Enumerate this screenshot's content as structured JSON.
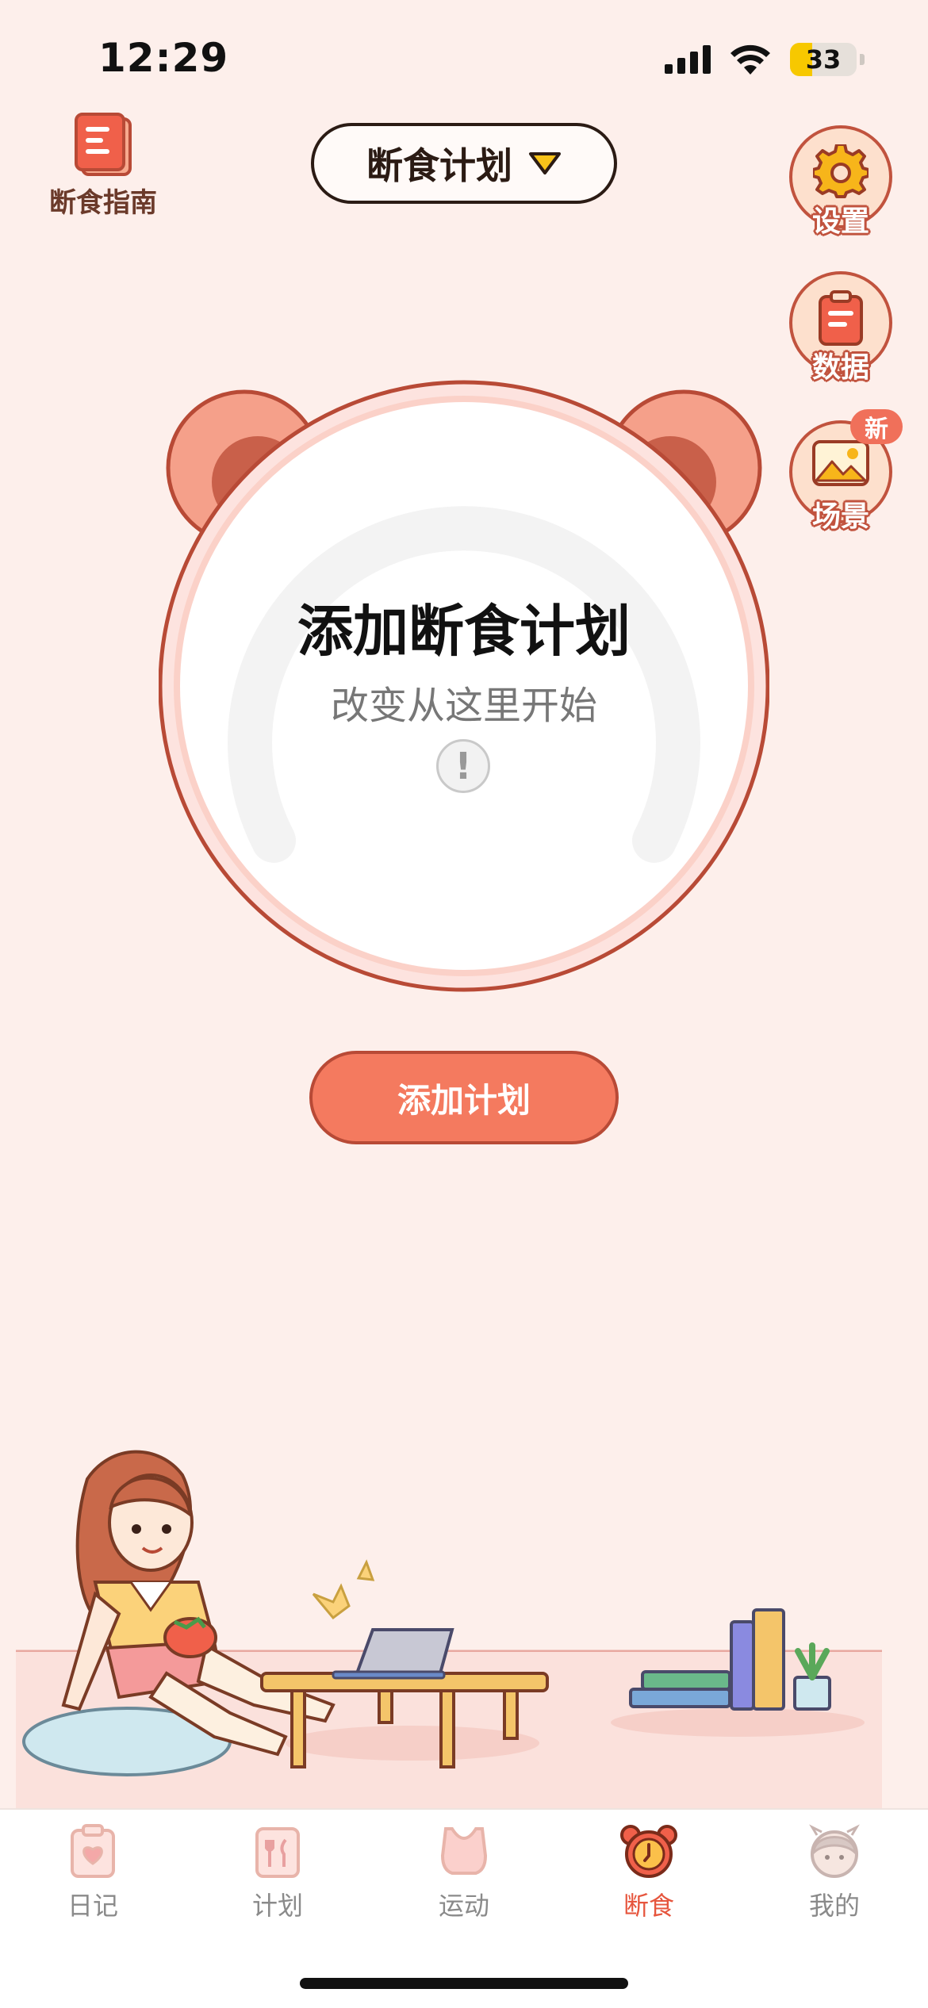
{
  "status_bar": {
    "time": "12:29",
    "battery": "33",
    "battery_fraction": 0.33
  },
  "header": {
    "guide_label": "断食指南",
    "plan_selector_label": "断食计划"
  },
  "side_buttons": {
    "settings_label": "设置",
    "data_label": "数据",
    "scene_label": "场景",
    "new_badge": "新"
  },
  "clock": {
    "title": "添加断食计划",
    "subtitle": "改变从这里开始",
    "info_symbol": "!"
  },
  "add_plan_button": "添加计划",
  "tabs": [
    {
      "label": "日记",
      "icon": "diary-icon"
    },
    {
      "label": "计划",
      "icon": "meal-plan-icon"
    },
    {
      "label": "运动",
      "icon": "sports-bra-icon"
    },
    {
      "label": "断食",
      "icon": "alarm-clock-icon",
      "active": true
    },
    {
      "label": "我的",
      "icon": "avatar-icon"
    }
  ],
  "colors": {
    "background": "#fdefeb",
    "accent": "#f47a5f",
    "active_tab": "#e6553d",
    "outline": "#c1533e"
  }
}
